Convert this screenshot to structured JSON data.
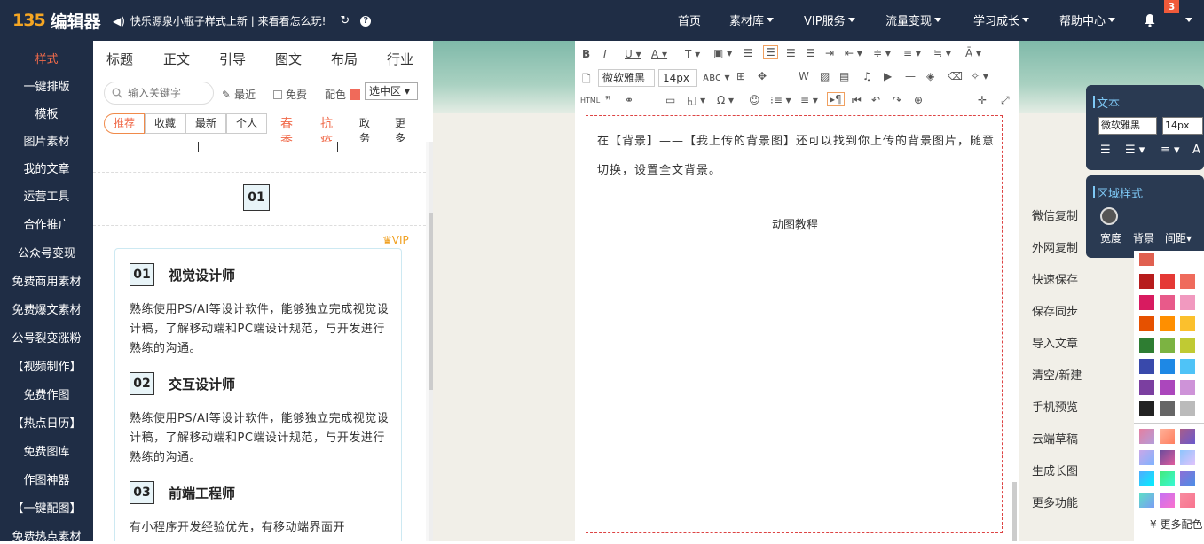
{
  "topbar": {
    "logo_mark": "135",
    "logo_name": "编辑器",
    "notice_text": "快乐源泉小瓶子样式上新 | 来看看怎么玩!",
    "nav": [
      {
        "label": "首页",
        "dropdown": false
      },
      {
        "label": "素材库",
        "dropdown": true
      },
      {
        "label": "VIP服务",
        "dropdown": true
      },
      {
        "label": "流量变现",
        "dropdown": true
      },
      {
        "label": "学习成长",
        "dropdown": true
      },
      {
        "label": "帮助中心",
        "dropdown": true
      }
    ],
    "notification_count": "3"
  },
  "sidebar": {
    "items": [
      "样式",
      "一键排版",
      "模板",
      "图片素材",
      "我的文章",
      "运营工具",
      "合作推广",
      "公众号变现",
      "免费商用素材",
      "免费爆文素材",
      "公号裂变涨粉",
      "【视频制作】",
      "免费作图",
      "【热点日历】",
      "免费图库",
      "作图神器",
      "【一键配图】",
      "免费热点素材"
    ],
    "active_index": 0
  },
  "panel": {
    "tabs": [
      "标题",
      "正文",
      "引导",
      "图文",
      "布局",
      "行业"
    ],
    "search_placeholder": "输入关键字",
    "recent_label": "最近",
    "free_label": "免费",
    "color_label": "配色",
    "color_swatch": "#f06a5a",
    "select_value": "选中区",
    "filter_chips": [
      "推荐",
      "收藏",
      "最新",
      "个人"
    ],
    "filter_links": [
      "春季",
      "抗疫",
      "政务",
      "更多"
    ],
    "number_badge": "01",
    "vip_label": "VIP",
    "card_items": [
      {
        "num": "01",
        "title": "视觉设计师",
        "desc": "熟练使用PS/AI等设计软件，能够独立完成视觉设计稿，了解移动端和PC端设计规范，与开发进行熟练的沟通。"
      },
      {
        "num": "02",
        "title": "交互设计师",
        "desc": "熟练使用PS/AI等设计软件，能够独立完成视觉设计稿，了解移动端和PC端设计规范，与开发进行熟练的沟通。"
      },
      {
        "num": "03",
        "title": "前端工程师",
        "desc": "有小程序开发经验优先，有移动端界面开"
      }
    ]
  },
  "editor": {
    "font_family": "微软雅黑",
    "font_size": "14px",
    "paragraph": "在【背景】——【我上传的背景图】还可以找到你上传的背景图片，随意切换，设置全文背景。",
    "center_text": "动图教程"
  },
  "actions": [
    "微信复制",
    "外网复制",
    "快速保存",
    "保存同步",
    "导入文章",
    "清空/新建",
    "手机预览",
    "云端草稿",
    "生成长图",
    "更多功能"
  ],
  "text_panel": {
    "title": "文本",
    "font_family": "微软雅黑",
    "font_size": "14px"
  },
  "region_panel": {
    "title": "区域样式",
    "labels": [
      "宽度",
      "背景",
      "间距"
    ]
  },
  "color_panel": {
    "more_label": "更多配色",
    "swatches": [
      "#b71c1c",
      "#e53935",
      "#ef6b5c",
      "#d81b60",
      "#e85a8a",
      "#f199bf",
      "#e65100",
      "#ff8f00",
      "#fbc02d",
      "#2e7d32",
      "#7cb342",
      "#c0ca33",
      "#3949ab",
      "#1e88e5",
      "#4fc3f7",
      "#7b3fa0",
      "#ab47bc",
      "#ce93d8",
      "#222222",
      "#666666",
      "#bbbbbb"
    ]
  }
}
